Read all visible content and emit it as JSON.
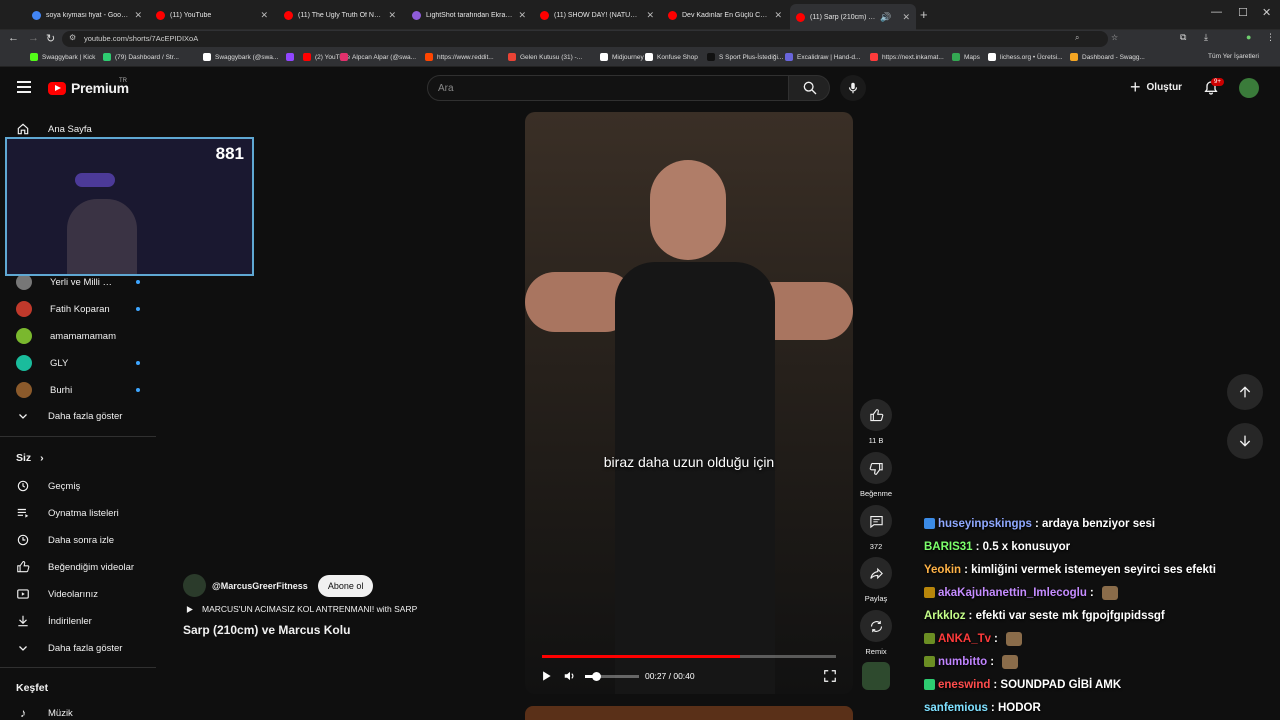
{
  "browser": {
    "tabs": [
      {
        "title": "soya kıyması fiyat - Google'da A",
        "color": "#4285f4"
      },
      {
        "title": "(11) YouTube",
        "color": "#ff0000"
      },
      {
        "title": "(11) The Ugly Truth Of Natural B",
        "color": "#ff0000"
      },
      {
        "title": "LightShot tarafından Ekran Görü",
        "color": "#8e5cd9"
      },
      {
        "title": "(11) SHOW DAY! (NATURAL MA",
        "color": "#ff0000"
      },
      {
        "title": "Dev Kadınlar En Güçlü Cücelere",
        "color": "#ff0000"
      },
      {
        "title": "(11) Sarp (210cm) ve Marcu",
        "color": "#ff0000"
      }
    ],
    "url": "youtube.com/shorts/7AcEPIDIXoA",
    "bookmarks": [
      {
        "label": "Swaggybark | Kick",
        "color": "#53fc18"
      },
      {
        "label": "(79) Dashboard / Str...",
        "color": "#2ecc71"
      },
      {
        "label": "Swaggybark (@swa...",
        "color": "#ffffff"
      },
      {
        "label": "",
        "color": "#9146ff"
      },
      {
        "label": "(2) YouTube",
        "color": "#ff0000"
      },
      {
        "label": "Alpcan Alpar (@swa...",
        "color": "#e1306c"
      },
      {
        "label": "https://www.reddit...",
        "color": "#ff4500"
      },
      {
        "label": "Gelen Kutusu (31) -...",
        "color": "#ea4335"
      },
      {
        "label": "Midjourney",
        "color": "#ffffff"
      },
      {
        "label": "Konfuse Shop",
        "color": "#ffffff"
      },
      {
        "label": "S Sport Plus-İstediği...",
        "color": "#111111"
      },
      {
        "label": "Excalidraw | Hand-d...",
        "color": "#6965db"
      },
      {
        "label": "https://next.inkamat...",
        "color": "#ff3b3b"
      },
      {
        "label": "Maps",
        "color": "#34a853"
      },
      {
        "label": "lichess.org • Ücretsi...",
        "color": "#ffffff"
      },
      {
        "label": "Dashboard - Swagg...",
        "color": "#f5a623"
      }
    ],
    "all_bookmarks": "Tüm Yer İşaretleri"
  },
  "header": {
    "logo": "Premium",
    "country": "TR",
    "search_placeholder": "Ara",
    "create_label": "Oluştur",
    "notifications": "9+"
  },
  "sidebar": {
    "home": "Ana Sayfa",
    "subscriptions": [
      {
        "label": "Yerli ve Milli Haw...",
        "color": "#777",
        "live": true
      },
      {
        "label": "Fatih Koparan",
        "color": "#c0392b",
        "live": true
      },
      {
        "label": "amamamamam",
        "color": "#7ab82e",
        "live": false
      },
      {
        "label": "GLY",
        "color": "#1abc9c",
        "live": true
      },
      {
        "label": "Burhi",
        "color": "#8b5a2b",
        "live": true
      }
    ],
    "show_more": "Daha fazla göster",
    "you_heading": "Siz",
    "you_items": [
      {
        "label": "Geçmiş",
        "icon": "history-icon"
      },
      {
        "label": "Oynatma listeleri",
        "icon": "playlists-icon"
      },
      {
        "label": "Daha sonra izle",
        "icon": "watch-later-icon"
      },
      {
        "label": "Beğendiğim videolar",
        "icon": "liked-icon"
      },
      {
        "label": "Videolarınız",
        "icon": "your-videos-icon"
      },
      {
        "label": "İndirilenler",
        "icon": "downloads-icon"
      }
    ],
    "show_more_2": "Daha fazla göster",
    "explore_heading": "Keşfet",
    "music": "Müzik"
  },
  "webcam": {
    "count": "881"
  },
  "video": {
    "subtitle": "biraz daha uzun olduğu için",
    "time": "00:27 / 00:40",
    "progress": 0.675,
    "volume": 0.2
  },
  "actions": {
    "likes": "11 B",
    "dislike": "Beğenme",
    "comments": "372",
    "share": "Paylaş",
    "remix": "Remix"
  },
  "channel": {
    "handle": "@MarcusGreerFitness",
    "subscribe": "Abone ol",
    "music": "MARCUS'UN ACIMASIZ KOL ANTRENMANI! with SARP",
    "title": "Sarp (210cm) ve Marcus Kolu"
  },
  "chat": [
    {
      "user": "huseyinpskingps",
      "color": "#8fa8ff",
      "message": ": ardaya benziyor sesi",
      "badge": "#3b8be6"
    },
    {
      "user": "BARIS31",
      "color": "#7cff6b",
      "message": ": 0.5 x konusuyor",
      "badge": ""
    },
    {
      "user": "Yeokin",
      "color": "#ffb347",
      "message": ": kimliğini vermek istemeyen seyirci ses efekti",
      "badge": ""
    },
    {
      "user": "akaKajuhanettin_Imlecoglu",
      "color": "#c58cff",
      "message": ":",
      "badge": "#b8860b"
    },
    {
      "user": "Arkkloz",
      "color": "#c6ff8a",
      "message": ": efekti var seste mk fgpojfgıpidssgf",
      "badge": ""
    },
    {
      "user": "ANKA_Tv",
      "color": "#ff3b3b",
      "message": ":",
      "badge": "#6b8e23"
    },
    {
      "user": "numbitto",
      "color": "#c084ff",
      "message": ":",
      "badge": "#6b8e23"
    },
    {
      "user": "eneswind",
      "color": "#ff4d4d",
      "message": ": SOUNDPAD GİBİ AMK",
      "badge": "#2ecc71"
    },
    {
      "user": "sanfemious",
      "color": "#7ee0ff",
      "message": ": HODOR",
      "badge": ""
    }
  ]
}
